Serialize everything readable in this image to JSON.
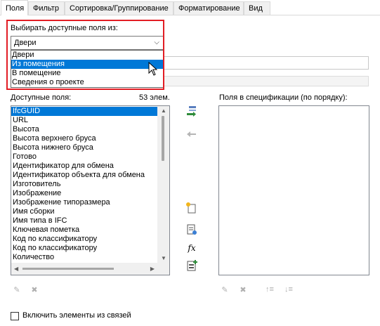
{
  "tabs": [
    {
      "label": "Поля",
      "active": true
    },
    {
      "label": "Фильтр"
    },
    {
      "label": "Сортировка/Группирование"
    },
    {
      "label": "Форматирование"
    },
    {
      "label": "Вид"
    }
  ],
  "select_from_label": "Выбирать доступные поля из:",
  "combo": {
    "selected": "Двери"
  },
  "dropdown_options": [
    "Двери",
    "Из помещения",
    "В помещение",
    "Сведения о проекте"
  ],
  "dropdown_highlighted": "Из помещения",
  "available": {
    "label": "Доступные поля:",
    "count": "53 элем.",
    "items": [
      "IfcGUID",
      "URL",
      "Высота",
      "Высота верхнего бруса",
      "Высота нижнего бруса",
      "Готово",
      "Идентификатор для обмена",
      "Идентификатор объекта для обмена",
      "Изготовитель",
      "Изображение",
      "Изображение типоразмера",
      "Имя сборки",
      "Имя типа в IFC",
      "Ключевая пометка",
      "Код по классификатору",
      "Код по классификатору",
      "Количество"
    ],
    "selected_index": 0
  },
  "scheduled": {
    "label": "Поля в спецификации (по порядку):",
    "items": []
  },
  "include_links_label": "Включить элементы из связей",
  "icons": {
    "add": "add-parameter-icon",
    "remove": "remove-parameter-icon",
    "new_param": "new-parameter-icon",
    "calc": "calculated-value-icon",
    "fx": "fx-icon",
    "combine": "combine-parameters-icon",
    "edit": "edit-icon",
    "delete": "delete-icon",
    "move_up": "move-up-icon",
    "move_down": "move-down-icon"
  },
  "colors": {
    "selection": "#0078d7",
    "highlight_frame": "#e21d24",
    "add_arrow": "#2e8b3a"
  }
}
